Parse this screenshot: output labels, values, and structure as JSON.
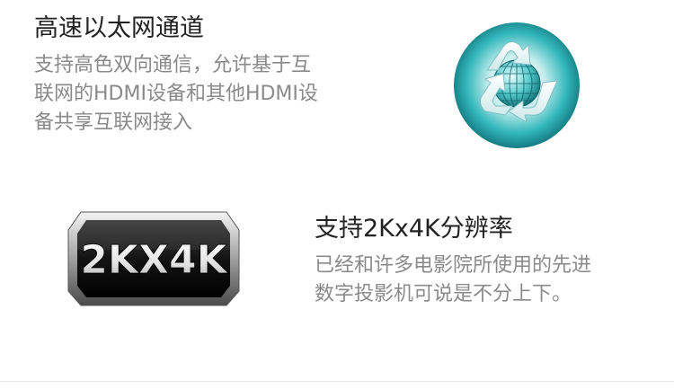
{
  "feature_ethernet": {
    "title": "高速以太网通道",
    "lines": [
      "支持高色双向通信，允许基于互",
      "联网的HDMI设备和其他HDMI设",
      "备共享互联网接入"
    ]
  },
  "feature_2k4k": {
    "title": "支持2Kx4K分辨率",
    "lines": [
      "已经和许多电影院所使用的先进",
      "数字投影机可说是不分上下。"
    ]
  },
  "badge": {
    "text": "2KX4K"
  },
  "colors": {
    "title": "#222222",
    "description": "#8a8a8a",
    "teal": "#28b3b7"
  }
}
